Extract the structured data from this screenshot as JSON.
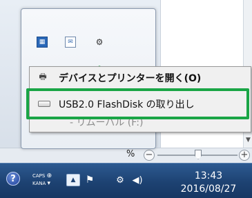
{
  "taskbar": {
    "help_icon_glyph": "?",
    "caps_label": "CAPS",
    "kana_label": "KANA",
    "clock": {
      "time": "13:43",
      "date": "2016/08/27"
    }
  },
  "app": {
    "zoom_percent": "%",
    "zoom_out": "−",
    "zoom_in": "+"
  },
  "context_menu": {
    "items": [
      {
        "label": "デバイスとプリンターを開く(O)",
        "icon": "printer-icon"
      },
      {
        "label": "USB2.0 FlashDisk の取り出し",
        "icon": "drive-icon"
      },
      {
        "label": "- リムーバル (F:)",
        "icon": ""
      }
    ]
  },
  "colors": {
    "highlight": "#1aa546",
    "taskbar": "#1d4272"
  }
}
